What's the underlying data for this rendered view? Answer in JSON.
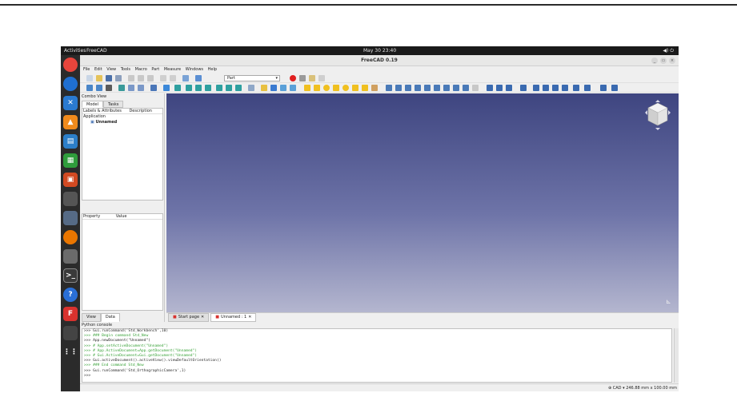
{
  "system": {
    "activities": "Activities",
    "app_name": "FreeCAD",
    "clock": "May 30 23:40",
    "tray": "◀) ⏻"
  },
  "window": {
    "title": "FreeCAD 0.19",
    "min_glyph": "_",
    "max_glyph": "▭",
    "close_glyph": "×"
  },
  "menu": [
    "File",
    "Edit",
    "View",
    "Tools",
    "Macro",
    "Part",
    "Measure",
    "Windows",
    "Help"
  ],
  "toolbar": {
    "workbench": "Part"
  },
  "combo": {
    "title": "Combo View",
    "tab_model": "Model",
    "tab_tasks": "Tasks",
    "tree_col1": "Labels & Attributes",
    "tree_col2": "Description",
    "tree_root": "Application",
    "tree_doc": "Unnamed",
    "prop_col1": "Property",
    "prop_col2": "Value",
    "tab_view": "View",
    "tab_data": "Data"
  },
  "doc_tabs": {
    "start": "Start page",
    "unnamed": "Unnamed : 1"
  },
  "console": {
    "title": "Python console",
    "lines": [
      {
        "t": ">>> Gui.runCommand('Std_Workbench',10)",
        "c": "l-cmd"
      },
      {
        "t": ">>> ### Begin command Std_New",
        "c": "l-com"
      },
      {
        "t": ">>> App.newDocument(\"Unnamed\")",
        "c": "l-cmd"
      },
      {
        "t": ">>> # App.setActiveDocument(\"Unnamed\")",
        "c": "l-com"
      },
      {
        "t": ">>> # App.ActiveDocument=App.getDocument(\"Unnamed\")",
        "c": "l-com"
      },
      {
        "t": ">>> # Gui.ActiveDocument=Gui.getDocument(\"Unnamed\")",
        "c": "l-com"
      },
      {
        "t": ">>> Gui.activeDocument().activeView().viewDefaultOrientation()",
        "c": "l-cmd"
      },
      {
        "t": ">>> ### End command Std_New",
        "c": "l-com"
      },
      {
        "t": ">>> Gui.runCommand('Std_OrthographicCamera',1)",
        "c": "l-cmd"
      },
      {
        "t": ">>> ",
        "c": "l-cmd"
      }
    ]
  },
  "status": {
    "right": "⊕ CAD ▾  246.88 mm x 100.00 mm"
  },
  "colors": {
    "accent": "#3e4580",
    "record": "#e02020"
  }
}
